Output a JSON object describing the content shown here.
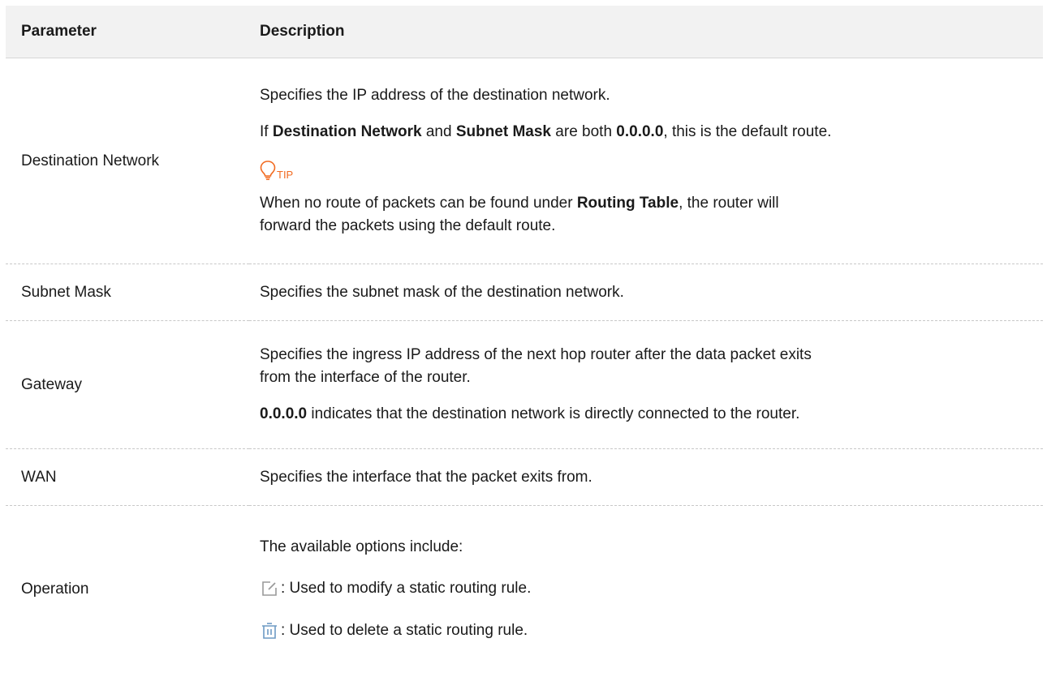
{
  "header": {
    "parameter": "Parameter",
    "description": "Description"
  },
  "rows": {
    "destination": {
      "name": "Destination Network",
      "line1": "Specifies the IP address of the destination network.",
      "line2": {
        "t1": "If ",
        "b1": "Destination Network",
        "t2": " and ",
        "b2": "Subnet Mask",
        "t3": " are both ",
        "b3": "0.0.0.0",
        "t4": ", this is the default route."
      },
      "tip_label": "TIP",
      "tip_icon": "lightbulb-icon",
      "tip_color": "#f26b21",
      "tip_line1": {
        "t1": "When no route of packets can be found under ",
        "b1": "Routing Table",
        "t2": ", the router will"
      },
      "tip_line2": "forward the packets using the default route."
    },
    "subnet": {
      "name": "Subnet Mask",
      "line1": "Specifies the subnet mask of the destination network."
    },
    "gateway": {
      "name": "Gateway",
      "line1": "Specifies the ingress IP address of the next hop router after the data packet exits",
      "line2": "from the interface of the router.",
      "line3": {
        "b1": "0.0.0.0",
        "t1": " indicates that the destination network is directly connected to the router."
      }
    },
    "wan": {
      "name": "WAN",
      "line1": "Specifies the interface that the packet exits from."
    },
    "operation": {
      "name": "Operation",
      "line1": "The available options include:",
      "edit_icon": "edit-icon",
      "edit_text": ": Used to modify a static routing rule.",
      "delete_icon": "delete-icon",
      "delete_text": ": Used to delete a static routing rule."
    }
  }
}
